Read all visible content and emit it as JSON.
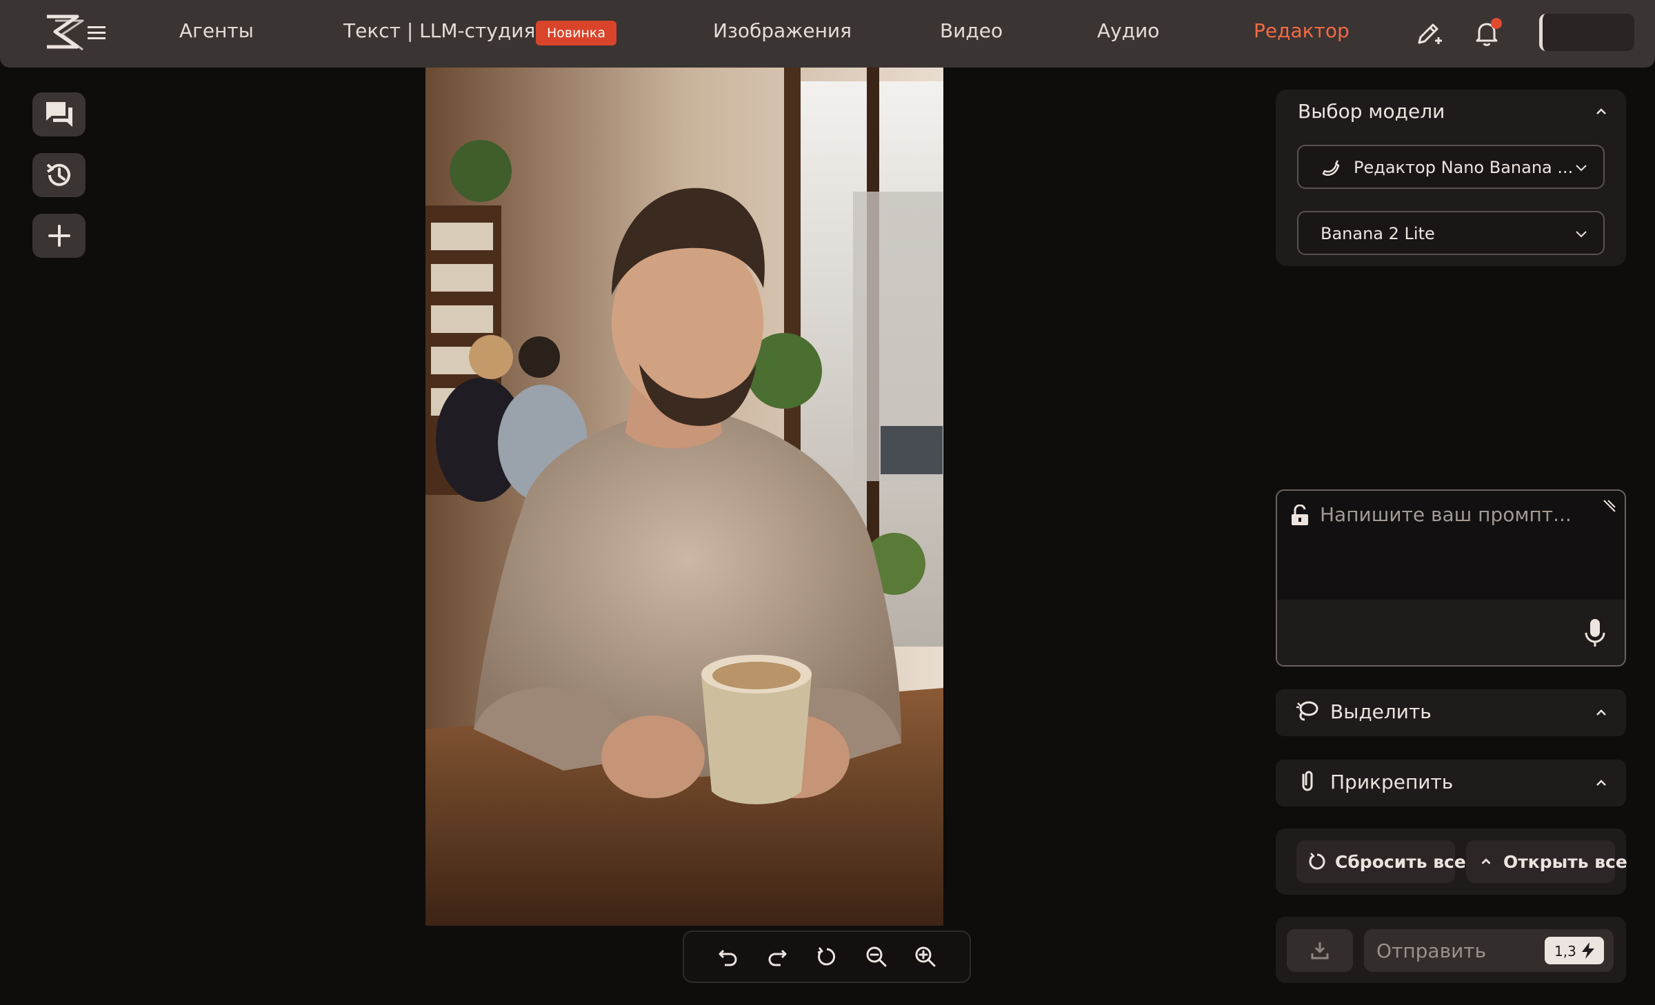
{
  "nav": {
    "agents": "Агенты",
    "text_studio": "Текст | LLM-студия",
    "badge_new": "Новинка",
    "images": "Изображения",
    "video": "Видео",
    "audio": "Аудио",
    "editor": "Редактор"
  },
  "colors": {
    "accent": "#f26a43",
    "badge": "#d9442a",
    "topbar": "#3a3433",
    "background": "#0f0c0c",
    "panel": "#1f1b1a"
  },
  "icons": {
    "logo": "logo-icon",
    "menu": "hamburger-icon",
    "edit": "pencil-sparkle-icon",
    "notifications": "bell-icon",
    "chats": "chat-bubbles-icon",
    "history": "history-icon",
    "new": "plus-icon",
    "lock": "unlock-icon",
    "mic": "microphone-icon",
    "select": "lasso-icon",
    "attach": "paperclip-icon",
    "reset": "reset-icon",
    "open_all": "chevron-up-icon",
    "download": "download-icon",
    "bolt": "lightning-icon"
  },
  "model_panel": {
    "title": "Выбор модели",
    "model_select": "Редактор Nano Banana ...",
    "version_select": "Banana 2 Lite"
  },
  "prompt": {
    "placeholder": "Напишите ваш промпт...",
    "value": ""
  },
  "sections": {
    "select_label": "Выделить",
    "attach_label": "Прикрепить"
  },
  "actions": {
    "reset_all": "Сбросить все",
    "open_all": "Открыть все"
  },
  "send": {
    "label": "Отправить",
    "cost": "1,3"
  }
}
